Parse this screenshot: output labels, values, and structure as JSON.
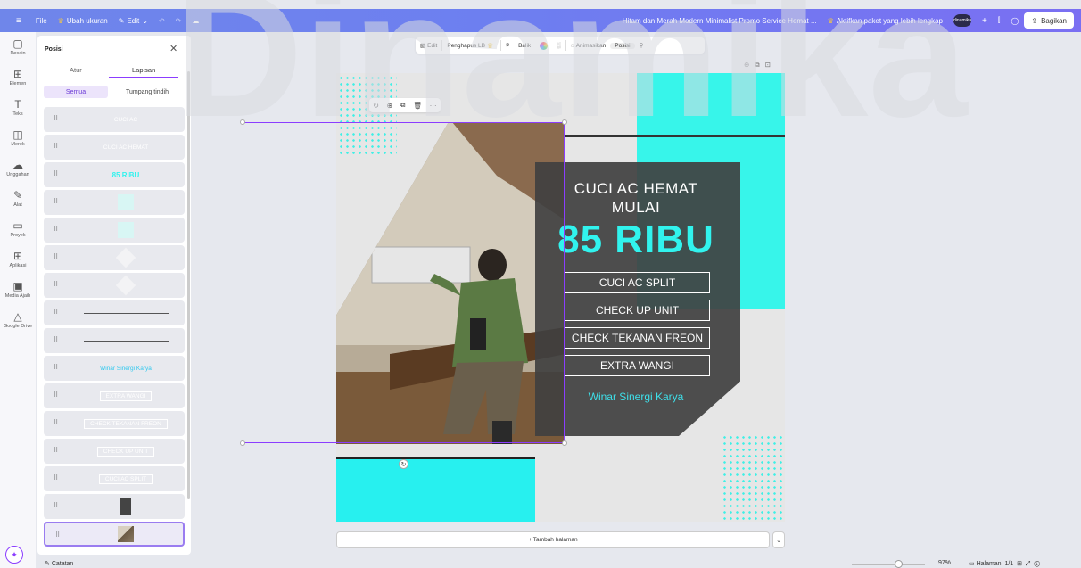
{
  "topbar": {
    "menu": "≡",
    "file": "File",
    "resize": "Ubah ukuran",
    "edit": "Edit",
    "doc_title": "Hitam dan Merah Modern Minimalist Promo Service Hemat ...",
    "upgrade": "Aktifkan paket yang lebih lengkap",
    "avatar": "dinamika",
    "share": "Bagikan"
  },
  "watermark": {
    "text": "Dinamika"
  },
  "rail": [
    {
      "icon": "▢",
      "label": "Desain"
    },
    {
      "icon": "⊞",
      "label": "Elemen"
    },
    {
      "icon": "T",
      "label": "Teks"
    },
    {
      "icon": "◫",
      "label": "Merek"
    },
    {
      "icon": "☁",
      "label": "Unggahan"
    },
    {
      "icon": "✎",
      "label": "Alat"
    },
    {
      "icon": "▭",
      "label": "Proyek"
    },
    {
      "icon": "⊞",
      "label": "Aplikasi"
    },
    {
      "icon": "▣",
      "label": "Media Ajaib"
    },
    {
      "icon": "△",
      "label": "Google Drive"
    }
  ],
  "panel": {
    "title": "Posisi",
    "tabs": [
      "Atur",
      "Lapisan"
    ],
    "subtabs": [
      "Semua",
      "Tumpang tindih"
    ],
    "layers": [
      {
        "text": "CUCI AC",
        "type": "text",
        "color": "#ffffff"
      },
      {
        "text": "CUCI AC HEMAT",
        "type": "text",
        "color": "#ffffff"
      },
      {
        "text": "85 RIBU",
        "type": "text",
        "color": "#31f3ee"
      },
      {
        "text": "",
        "type": "cyan"
      },
      {
        "text": "",
        "type": "cyan"
      },
      {
        "text": "",
        "type": "dots"
      },
      {
        "text": "",
        "type": "dots"
      },
      {
        "text": "",
        "type": "line"
      },
      {
        "text": "",
        "type": "line"
      },
      {
        "text": "Winar Sinergi Karya",
        "type": "text",
        "color": "#31c8ee"
      },
      {
        "text": "EXTRA WANGI",
        "type": "boxed"
      },
      {
        "text": "CHECK TEKANAN FREON",
        "type": "boxed"
      },
      {
        "text": "CHECK UP UNIT",
        "type": "boxed"
      },
      {
        "text": "CUCI AC SPLIT",
        "type": "boxed"
      },
      {
        "text": "",
        "type": "dark"
      },
      {
        "text": "",
        "type": "photo"
      }
    ]
  },
  "toolbar": {
    "edit": "Edit",
    "eraser": "Penghapus LB",
    "flip": "Balik",
    "animate": "Animasikan",
    "position": "Posisi"
  },
  "design": {
    "headline1": "CUCI AC HEMAT",
    "headline2": "MULAI",
    "price": "85 RIBU",
    "services": [
      "CUCI AC SPLIT",
      "CHECK UP UNIT",
      "CHECK TEKANAN FREON",
      "EXTRA WANGI"
    ],
    "brand": "Winar Sinergi Karya"
  },
  "add_page": "+ Tambah halaman",
  "footer": {
    "notes": "Catatan",
    "zoom": "97%",
    "pages_label": "Halaman",
    "pages_value": "1/1"
  },
  "colors": {
    "accent": "#8b3dff",
    "cyan": "#37f5ea",
    "dark": "#404040",
    "topbar": "#6d7ff0"
  }
}
